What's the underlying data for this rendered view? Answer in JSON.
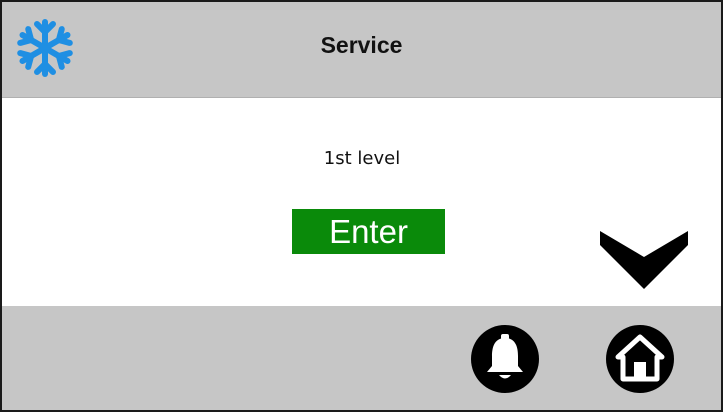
{
  "header": {
    "title": "Service",
    "icon": "snowflake-icon",
    "icon_color": "#1f8fe3"
  },
  "content": {
    "level_text": "1st level",
    "enter_label": "Enter",
    "enter_color": "#0a8a0a",
    "nav_icon": "chevron-down-icon"
  },
  "footer": {
    "buttons": [
      {
        "icon": "bell-icon"
      },
      {
        "icon": "home-icon"
      }
    ]
  },
  "colors": {
    "bar_background": "#c6c6c6",
    "content_background": "#ffffff"
  }
}
